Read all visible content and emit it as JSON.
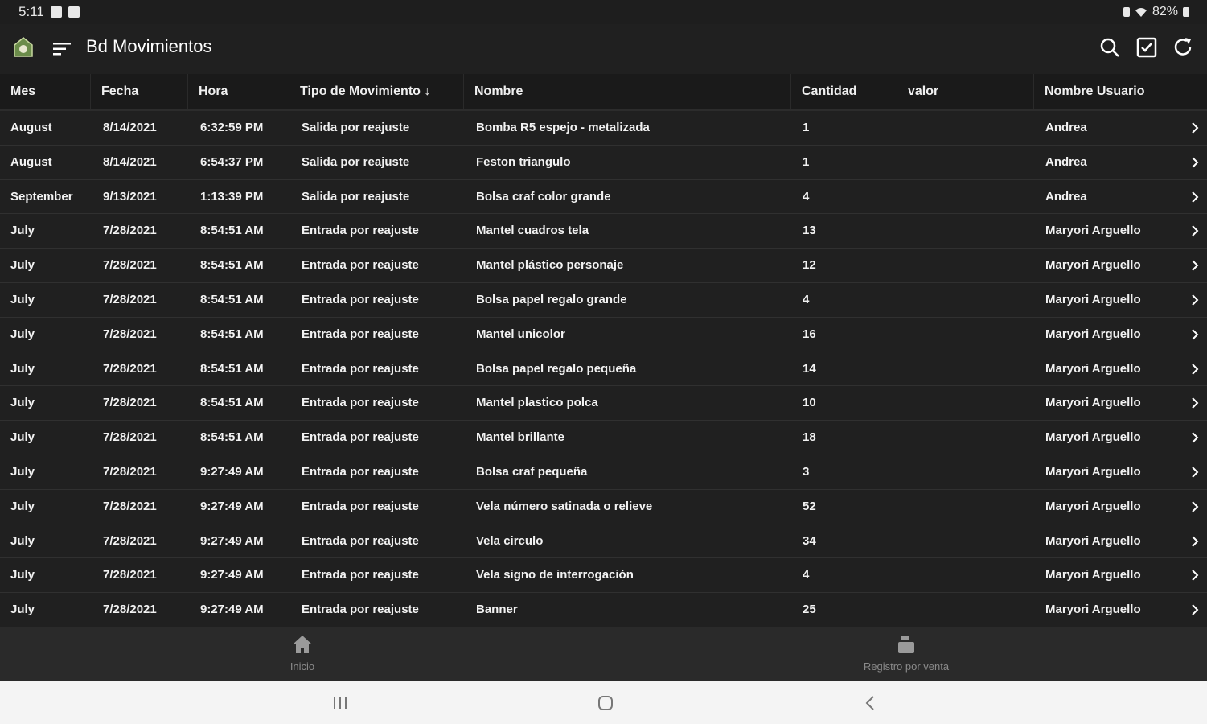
{
  "status_bar": {
    "time": "5:11",
    "battery": "82%"
  },
  "app_bar": {
    "title": "Bd Movimientos",
    "actions": [
      "search-icon",
      "checkbox-icon",
      "refresh-icon"
    ]
  },
  "columns": [
    "Mes",
    "Fecha",
    "Hora",
    "Tipo de Movimiento",
    "Nombre",
    "Cantidad",
    "valor",
    "Nombre Usuario"
  ],
  "sort_indicator": "↓",
  "rows": [
    [
      "August",
      "8/14/2021",
      "6:32:59 PM",
      "Salida por reajuste",
      "Bomba R5 espejo - metalizada",
      "1",
      "",
      "Andrea"
    ],
    [
      "August",
      "8/14/2021",
      "6:54:37 PM",
      "Salida por reajuste",
      "Feston triangulo",
      "1",
      "",
      "Andrea"
    ],
    [
      "September",
      "9/13/2021",
      "1:13:39 PM",
      "Salida por reajuste",
      "Bolsa craf color grande",
      "4",
      "",
      "Andrea"
    ],
    [
      "July",
      "7/28/2021",
      "8:54:51 AM",
      "Entrada por reajuste",
      "Mantel cuadros tela",
      "13",
      "",
      "Maryori Arguello"
    ],
    [
      "July",
      "7/28/2021",
      "8:54:51 AM",
      "Entrada por reajuste",
      "Mantel plástico personaje",
      "12",
      "",
      "Maryori Arguello"
    ],
    [
      "July",
      "7/28/2021",
      "8:54:51 AM",
      "Entrada por reajuste",
      "Bolsa papel regalo grande",
      "4",
      "",
      "Maryori Arguello"
    ],
    [
      "July",
      "7/28/2021",
      "8:54:51 AM",
      "Entrada por reajuste",
      "Mantel unicolor",
      "16",
      "",
      "Maryori Arguello"
    ],
    [
      "July",
      "7/28/2021",
      "8:54:51 AM",
      "Entrada por reajuste",
      "Bolsa papel regalo pequeña",
      "14",
      "",
      "Maryori Arguello"
    ],
    [
      "July",
      "7/28/2021",
      "8:54:51 AM",
      "Entrada por reajuste",
      "Mantel plastico polca",
      "10",
      "",
      "Maryori Arguello"
    ],
    [
      "July",
      "7/28/2021",
      "8:54:51 AM",
      "Entrada por reajuste",
      "Mantel brillante",
      "18",
      "",
      "Maryori Arguello"
    ],
    [
      "July",
      "7/28/2021",
      "9:27:49 AM",
      "Entrada por reajuste",
      "Bolsa craf pequeña",
      "3",
      "",
      "Maryori Arguello"
    ],
    [
      "July",
      "7/28/2021",
      "9:27:49 AM",
      "Entrada por reajuste",
      "Vela número satinada o relieve",
      "52",
      "",
      "Maryori Arguello"
    ],
    [
      "July",
      "7/28/2021",
      "9:27:49 AM",
      "Entrada por reajuste",
      "Vela circulo",
      "34",
      "",
      "Maryori Arguello"
    ],
    [
      "July",
      "7/28/2021",
      "9:27:49 AM",
      "Entrada por reajuste",
      "Vela signo de interrogación",
      "4",
      "",
      "Maryori Arguello"
    ],
    [
      "July",
      "7/28/2021",
      "9:27:49 AM",
      "Entrada por reajuste",
      "Banner",
      "25",
      "",
      "Maryori Arguello"
    ]
  ],
  "bottom_nav": [
    {
      "label": "Inicio",
      "icon": "home-icon"
    },
    {
      "label": "Registro por venta",
      "icon": "cash-register-icon"
    }
  ],
  "colors": {
    "background": "#202020",
    "header": "#1a1a1a",
    "bottom_nav": "#2a2a2a"
  }
}
